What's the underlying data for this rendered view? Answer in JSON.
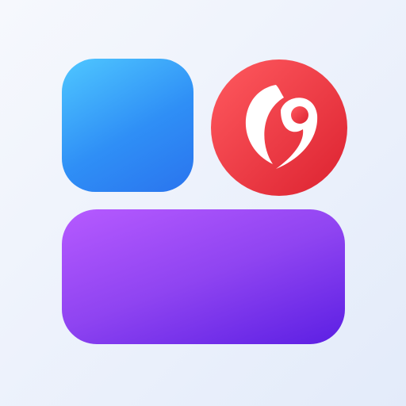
{
  "app_icon": {
    "background_colors": [
      "#f6f8fd",
      "#e3ebfa"
    ],
    "widgets": [
      {
        "name": "square-widget",
        "colors": [
          "#4fc7ff",
          "#2a74ee"
        ]
      },
      {
        "name": "wide-widget",
        "colors": [
          "#b65aff",
          "#5c1fe3"
        ]
      }
    ],
    "badge": {
      "icon": "curved-quote-icon",
      "fill_color": "#ea2c37",
      "glyph_color": "#ffffff"
    }
  }
}
